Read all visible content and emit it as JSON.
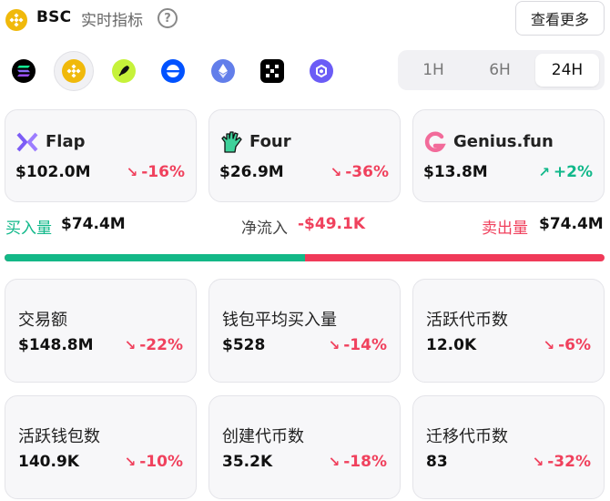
{
  "header": {
    "chain_name": "BSC",
    "title": "实时指标",
    "view_more_label": "查看更多"
  },
  "chains": [
    {
      "name": "solana",
      "icon": "solana-icon",
      "color": "#000000",
      "active": false
    },
    {
      "name": "bsc",
      "icon": "bnb-icon",
      "color": "#F0B90B",
      "active": true
    },
    {
      "name": "pump",
      "icon": "rocket-icon",
      "color": "#C6F23A",
      "active": false
    },
    {
      "name": "base",
      "icon": "base-icon",
      "color": "#0052FF",
      "active": false
    },
    {
      "name": "ethereum",
      "icon": "ethereum-icon",
      "color": "#627EEA",
      "active": false
    },
    {
      "name": "xlayer",
      "icon": "xlayer-icon",
      "color": "#000000",
      "active": false
    },
    {
      "name": "chainlink-like",
      "icon": "hexagon-icon",
      "color": "#6B5CF6",
      "active": false
    }
  ],
  "timeframes": {
    "options": [
      "1H",
      "6H",
      "24H"
    ],
    "selected": "24H"
  },
  "platforms": [
    {
      "name": "Flap",
      "icon": "flap-icon",
      "volume": "$102.0M",
      "change": "-16%",
      "direction": "down"
    },
    {
      "name": "Four",
      "icon": "four-hand-icon",
      "volume": "$26.9M",
      "change": "-36%",
      "direction": "down"
    },
    {
      "name": "Genius.fun",
      "icon": "genius-icon",
      "volume": "$13.8M",
      "change": "+2%",
      "direction": "up"
    }
  ],
  "flow": {
    "buy_label": "买入量",
    "buy_value": "$74.4M",
    "net_label": "净流入",
    "net_value": "-$49.1K",
    "sell_label": "卖出量",
    "sell_value": "$74.4M",
    "buy_ratio": 0.5
  },
  "metrics": [
    {
      "label": "交易额",
      "value": "$148.8M",
      "change": "-22%",
      "direction": "down"
    },
    {
      "label": "钱包平均买入量",
      "value": "$528",
      "change": "-14%",
      "direction": "down"
    },
    {
      "label": "活跃代币数",
      "value": "12.0K",
      "change": "-6%",
      "direction": "down"
    },
    {
      "label": "活跃钱包数",
      "value": "140.9K",
      "change": "-10%",
      "direction": "down"
    },
    {
      "label": "创建代币数",
      "value": "35.2K",
      "change": "-18%",
      "direction": "down"
    },
    {
      "label": "迁移代币数",
      "value": "83",
      "change": "-32%",
      "direction": "down"
    }
  ],
  "colors": {
    "positive": "#11b88a",
    "negative": "#f0415d"
  }
}
